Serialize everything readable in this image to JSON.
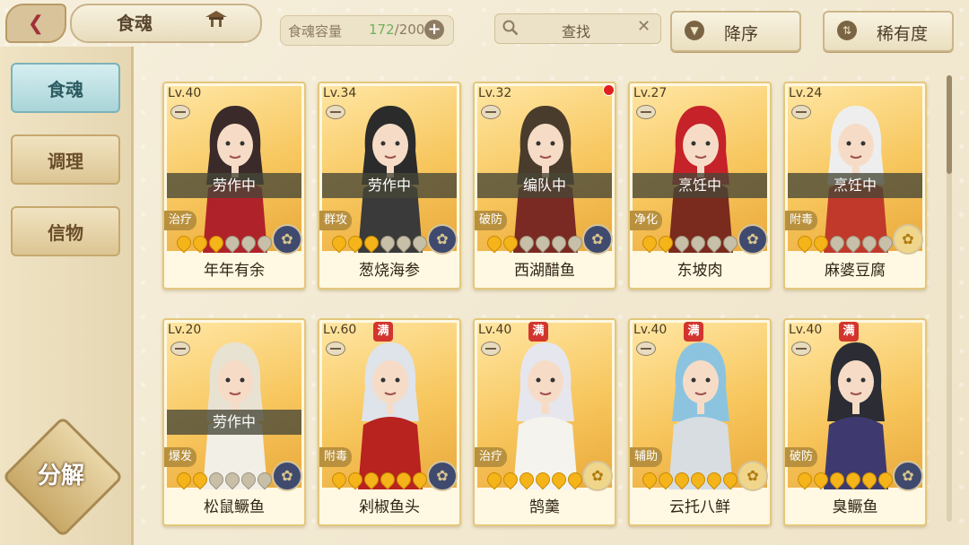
{
  "header": {
    "back_icon": "back-arrow-icon",
    "title": "食魂",
    "capacity_label": "食魂容量",
    "capacity_current": "172",
    "capacity_total": "/200",
    "capacity_add": "+",
    "search_label": "查找",
    "search_clear": "✕",
    "sort_desc_label": "降序",
    "sort_rarity_label": "稀有度"
  },
  "sidebar": {
    "tabs": [
      {
        "label": "食魂",
        "active": true
      },
      {
        "label": "调理",
        "active": false
      },
      {
        "label": "信物",
        "active": false
      }
    ],
    "decompose_label": "分解"
  },
  "cards": [
    {
      "level": "Lv.40",
      "status": "劳作中",
      "role": "治疗",
      "stars_on": 3,
      "stars_total": 6,
      "name": "年年有余",
      "max": false,
      "emblem": "blue",
      "hair": "#3a2a2a",
      "outfit": "#b0222a"
    },
    {
      "level": "Lv.34",
      "status": "劳作中",
      "role": "群攻",
      "stars_on": 3,
      "stars_total": 6,
      "name": "葱烧海参",
      "max": false,
      "emblem": "blue",
      "hair": "#2b2b2b",
      "outfit": "#3a3a3a"
    },
    {
      "level": "Lv.32",
      "status": "编队中",
      "role": "破防",
      "stars_on": 2,
      "stars_total": 6,
      "name": "西湖醋鱼",
      "max": false,
      "emblem": "blue",
      "hair": "#4a3c2c",
      "outfit": "#7a2a22",
      "notice": true
    },
    {
      "level": "Lv.27",
      "status": "烹饪中",
      "role": "净化",
      "stars_on": 2,
      "stars_total": 6,
      "name": "东坡肉",
      "max": false,
      "emblem": "blue",
      "hair": "#c6222a",
      "outfit": "#7b2a1e"
    },
    {
      "level": "Lv.24",
      "status": "烹饪中",
      "role": "附毒",
      "stars_on": 2,
      "stars_total": 6,
      "name": "麻婆豆腐",
      "max": false,
      "emblem": "gold",
      "hair": "#eeeeee",
      "outfit": "#c0392b"
    },
    {
      "level": "Lv.20",
      "status": "劳作中",
      "role": "爆发",
      "stars_on": 2,
      "stars_total": 6,
      "name": "松鼠鳜鱼",
      "max": false,
      "emblem": "blue",
      "hair": "#e8e2d2",
      "outfit": "#f2efe7"
    },
    {
      "level": "Lv.60",
      "status": "",
      "role": "附毒",
      "stars_on": 6,
      "stars_total": 6,
      "name": "剁椒鱼头",
      "max": true,
      "emblem": "blue",
      "hair": "#dfe3ea",
      "outfit": "#b8221f"
    },
    {
      "level": "Lv.40",
      "status": "",
      "role": "治疗",
      "stars_on": 6,
      "stars_total": 6,
      "name": "鹄羹",
      "max": true,
      "emblem": "gold",
      "hair": "#e6e6ee",
      "outfit": "#f5f3ee"
    },
    {
      "level": "Lv.40",
      "status": "",
      "role": "辅助",
      "stars_on": 6,
      "stars_total": 6,
      "name": "云托八鲜",
      "max": true,
      "emblem": "gold",
      "hair": "#8cc4e0",
      "outfit": "#d8dde2"
    },
    {
      "level": "Lv.40",
      "status": "",
      "role": "破防",
      "stars_on": 6,
      "stars_total": 6,
      "name": "臭鳜鱼",
      "max": true,
      "emblem": "blue",
      "hair": "#2c2c34",
      "outfit": "#3e3a70"
    }
  ],
  "labels": {
    "max_badge": "满"
  },
  "colors": {
    "accent": "#e4c77b",
    "active_tab": "#a9d4d8",
    "capacity_current": "#6fb25a"
  }
}
